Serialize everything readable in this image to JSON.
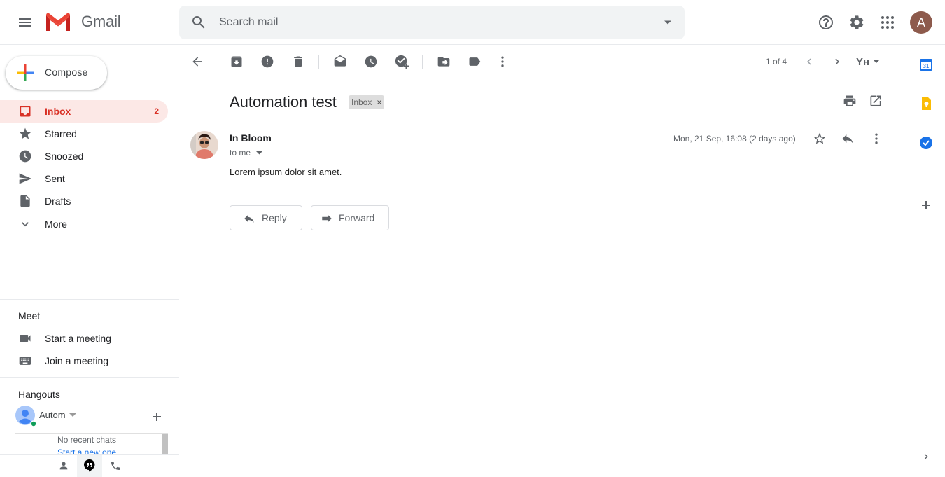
{
  "header": {
    "app_name": "Gmail",
    "search_placeholder": "Search mail",
    "avatar_letter": "A"
  },
  "compose": {
    "label": "Compose"
  },
  "nav": {
    "items": [
      {
        "label": "Inbox",
        "count": "2",
        "icon": "inbox-icon",
        "active": true
      },
      {
        "label": "Starred",
        "count": "",
        "icon": "star-icon"
      },
      {
        "label": "Snoozed",
        "count": "",
        "icon": "clock-icon"
      },
      {
        "label": "Sent",
        "count": "",
        "icon": "send-icon"
      },
      {
        "label": "Drafts",
        "count": "",
        "icon": "draft-icon"
      },
      {
        "label": "More",
        "count": "",
        "icon": "chevron-down-icon"
      }
    ]
  },
  "meet": {
    "title": "Meet",
    "start": "Start a meeting",
    "join": "Join a meeting"
  },
  "hangouts": {
    "title": "Hangouts",
    "user": "Autom",
    "no_chats": "No recent chats",
    "start_new": "Start a new one"
  },
  "toolbar": {
    "pager": "1 of 4",
    "input_tool": "Yн"
  },
  "message": {
    "subject": "Automation test",
    "label": "Inbox",
    "label_remove": "×",
    "sender": "In Bloom",
    "to": "to me",
    "date": "Mon, 21 Sep, 16:08 (2 days ago)",
    "body": "Lorem ipsum dolor sit amet."
  },
  "actions": {
    "reply": "Reply",
    "forward": "Forward"
  },
  "side_panel": {
    "calendar_day": "31"
  },
  "colors": {
    "accent_red": "#d93025",
    "inbox_bg": "#fce8e6",
    "avatar_bg": "#8d5a4c"
  }
}
